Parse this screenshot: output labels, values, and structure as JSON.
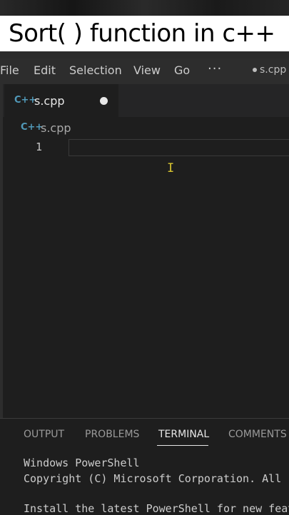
{
  "video_title": "Sort( ) function in c++",
  "menu": {
    "items": [
      "File",
      "Edit",
      "Selection",
      "View",
      "Go"
    ],
    "more": "···",
    "window_title": "s.cpp"
  },
  "editor": {
    "tab": {
      "icon": "C++",
      "label": "s.cpp",
      "unsaved": true
    },
    "breadcrumb": {
      "icon": "C++",
      "label": "s.cpp"
    },
    "line_numbers": [
      "1"
    ],
    "lines": [
      ""
    ]
  },
  "panel": {
    "tabs": [
      "OUTPUT",
      "PROBLEMS",
      "TERMINAL",
      "COMMENTS"
    ],
    "active_tab": "TERMINAL",
    "terminal_lines": [
      "Windows PowerShell",
      "Copyright (C) Microsoft Corporation. All rights reserved.",
      "",
      "Install the latest PowerShell for new features and improvements!"
    ]
  },
  "colors": {
    "editor_bg": "#1e1e1e",
    "menubar_bg": "#2d2d2d",
    "cpp_icon": "#519aba",
    "cursor": "#d7c430"
  }
}
